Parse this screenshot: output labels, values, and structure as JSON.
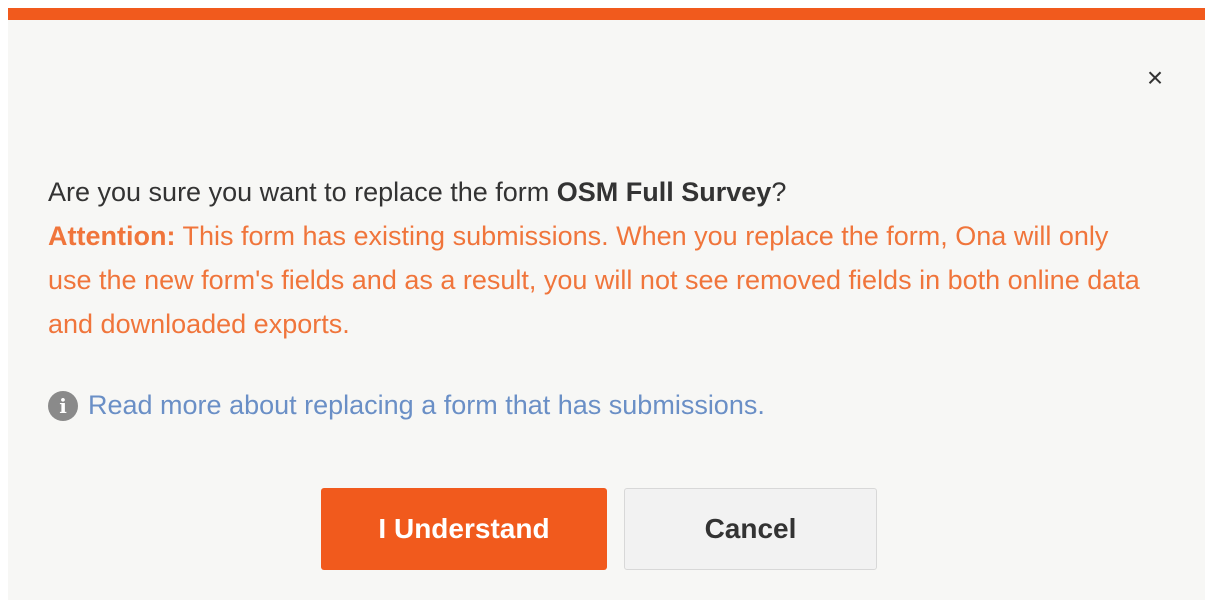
{
  "modal": {
    "close_icon": "×",
    "question_prefix": "Are you sure you want to replace the form ",
    "form_name": "OSM Full Survey",
    "question_suffix": "?",
    "attention_label": "Attention:",
    "attention_text": " This form has existing submissions. When you replace the form, Ona will only use the new form's fields and as a result, you will not see removed fields in both online data and downloaded exports.",
    "info_icon": "i",
    "info_link": "Read more about replacing a form that has submissions.",
    "confirm_label": "I Understand",
    "cancel_label": "Cancel"
  },
  "colors": {
    "accent": "#f15a1d",
    "warning_text": "#f0753b",
    "link": "#6a8fc6"
  }
}
